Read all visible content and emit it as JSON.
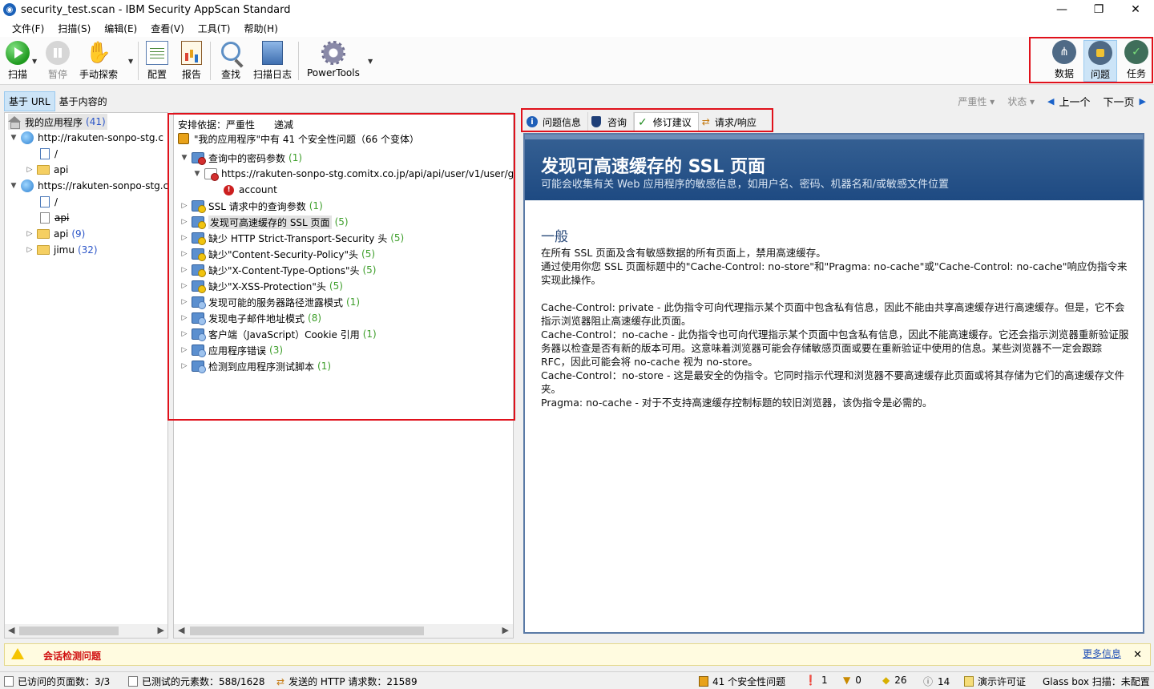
{
  "window": {
    "title": "security_test.scan - IBM Security AppScan Standard",
    "minimize": "—",
    "maximize": "❐",
    "close": "✕"
  },
  "menu": [
    "文件(F)",
    "扫描(S)",
    "编辑(E)",
    "查看(V)",
    "工具(T)",
    "帮助(H)"
  ],
  "toolbar": {
    "scan": "扫描",
    "pause": "暂停",
    "manual_explore": "手动探索",
    "config": "配置",
    "report": "报告",
    "find": "查找",
    "scan_log": "扫描日志",
    "power_tools": "PowerTools"
  },
  "right_toolbar": {
    "data": "数据",
    "issues": "问题",
    "tasks": "任务"
  },
  "view_bar": {
    "url_based": "基于 URL",
    "content_based": "基于内容的",
    "severity": "严重性 ▾",
    "status": "状态 ▾",
    "prev": "上一个",
    "next": "下一页"
  },
  "app_tree": {
    "root_label": "我的应用程序",
    "root_count": "(41)",
    "items": [
      {
        "label": "http://rakuten-sonpo-stg.c"
      },
      {
        "label": "/"
      },
      {
        "label": "api"
      },
      {
        "label": "https://rakuten-sonpo-stg.c"
      },
      {
        "label": "/"
      },
      {
        "label": "api"
      },
      {
        "label": "api",
        "count": "(9)"
      },
      {
        "label": "jimu",
        "count": "(32)"
      }
    ]
  },
  "issue_tree": {
    "sort_label": "安排依据：严重性",
    "sort_order": "递减",
    "summary": "\"我的应用程序\"中有 41 个安全性问题（66 个变体）",
    "items": [
      {
        "label": "查询中的密码参数",
        "count": "(1)"
      },
      {
        "label": "https://rakuten-sonpo-stg.comitx.co.jp/api/api/user/v1/user/g"
      },
      {
        "label": "account"
      },
      {
        "label": "SSL 请求中的查询参数",
        "count": "(1)"
      },
      {
        "label": "发现可高速缓存的 SSL 页面",
        "count": "(5)"
      },
      {
        "label": "缺少 HTTP Strict-Transport-Security 头",
        "count": "(5)"
      },
      {
        "label": "缺少\"Content-Security-Policy\"头",
        "count": "(5)"
      },
      {
        "label": "缺少\"X-Content-Type-Options\"头",
        "count": "(5)"
      },
      {
        "label": "缺少\"X-XSS-Protection\"头",
        "count": "(5)"
      },
      {
        "label": "发现可能的服务器路径泄露模式",
        "count": "(1)"
      },
      {
        "label": "发现电子邮件地址模式",
        "count": "(8)"
      },
      {
        "label": "客户端（JavaScript）Cookie 引用",
        "count": "(1)"
      },
      {
        "label": "应用程序错误",
        "count": "(3)"
      },
      {
        "label": "检测到应用程序测试脚本",
        "count": "(1)"
      }
    ]
  },
  "detail_tabs": {
    "issue_info": "问题信息",
    "advisory": "咨询",
    "fix": "修订建议",
    "req_resp": "请求/响应"
  },
  "detail": {
    "title": "发现可高速缓存的 SSL 页面",
    "subtitle": "可能会收集有关 Web 应用程序的敏感信息，如用户名、密码、机器名和/或敏感文件位置",
    "section": "一般",
    "p1": "在所有 SSL 页面及含有敏感数据的所有页面上，禁用高速缓存。",
    "p2": "通过使用你您 SSL 页面标题中的\"Cache-Control: no-store\"和\"Pragma: no-cache\"或\"Cache-Control: no-cache\"响应伪指令来实现此操作。",
    "p3": "Cache-Control: private - 此伪指令可向代理指示某个页面中包含私有信息，因此不能由共享高速缓存进行高速缓存。但是，它不会指示浏览器阻止高速缓存此页面。",
    "p4": "Cache-Control：no-cache - 此伪指令也可向代理指示某个页面中包含私有信息，因此不能高速缓存。它还会指示浏览器重新验证服务器以检查是否有新的版本可用。这意味着浏览器可能会存储敏感页面或要在重新验证中使用的信息。某些浏览器不一定会跟踪 RFC，因此可能会将 no-cache 视为 no-store。",
    "p5": "Cache-Control：no-store - 这是最安全的伪指令。它同时指示代理和浏览器不要高速缓存此页面或将其存储为它们的高速缓存文件夹。",
    "p6": "Pragma: no-cache - 对于不支持高速缓存控制标题的较旧浏览器，该伪指令是必需的。"
  },
  "warning": {
    "text": "会话检测问题",
    "more": "更多信息",
    "close": "✕"
  },
  "status": {
    "visited_pages": "已访问的页面数：3/3",
    "tested_elements": "已测试的元素数：588/1628",
    "http_requests": "发送的 HTTP 请求数：21589",
    "security_issues": "41 个安全性问题",
    "high": "1",
    "medium": "0",
    "low": "26",
    "info": "14",
    "license": "演示许可证",
    "glassbox": "Glass box 扫描：未配置"
  }
}
